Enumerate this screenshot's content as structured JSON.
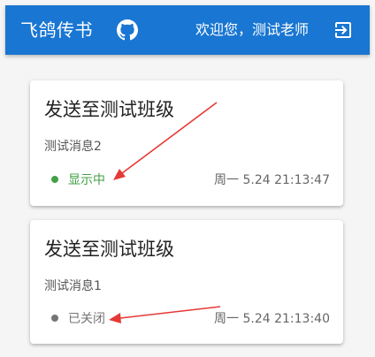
{
  "header": {
    "title": "飞鸽传书",
    "welcome": "欢迎您，测试老师",
    "icons": {
      "github": "github-icon",
      "logout": "logout-icon"
    }
  },
  "notifications": [
    {
      "title": "发送至测试班级",
      "message": "测试消息2",
      "status": "显示中",
      "status_color": "#43a047",
      "time": "周一 5.24 21:13:47"
    },
    {
      "title": "发送至测试班级",
      "message": "测试消息1",
      "status": "已关闭",
      "status_color": "#757575",
      "time": "周一 5.24 21:13:40"
    }
  ],
  "colors": {
    "app_bar": "#1976d2",
    "annotation_arrow": "#e53935"
  }
}
